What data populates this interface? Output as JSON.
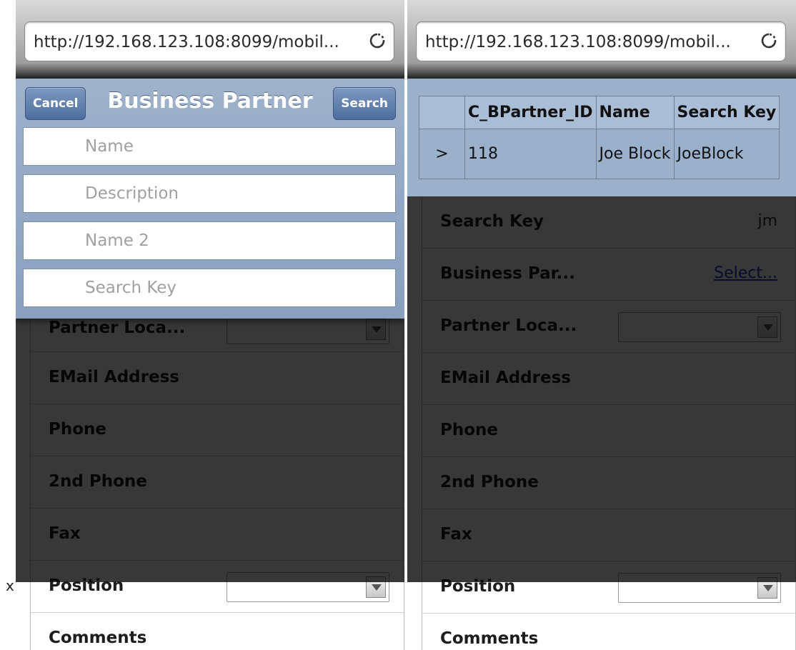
{
  "marker": "x",
  "left_screen": {
    "url": "http://192.168.123.108:8099/mobil...",
    "dialog": {
      "title": "Business Partner",
      "cancel_label": "Cancel",
      "search_label": "Search",
      "placeholders": [
        "Name",
        "Description",
        "Name 2",
        "Search Key"
      ]
    },
    "form_labels": {
      "partner_location": "Partner Loca...",
      "email": "EMail Address",
      "phone": "Phone",
      "phone2": "2nd Phone",
      "fax": "Fax",
      "position": "Position",
      "comments": "Comments"
    }
  },
  "right_screen": {
    "url": "http://192.168.123.108:8099/mobil...",
    "results_table": {
      "headers": [
        "",
        "C_BPartner_ID",
        "Name",
        "Search Key"
      ],
      "rows": [
        [
          ">",
          "118",
          "Joe Block",
          "JoeBlock"
        ]
      ]
    },
    "form": {
      "search_key_label": "Search Key",
      "search_key_value": "jm",
      "business_partner_label": "Business Par...",
      "business_partner_link": "Select...",
      "partner_location": "Partner Loca...",
      "email": "EMail Address",
      "phone": "Phone",
      "phone2": "2nd Phone",
      "fax": "Fax",
      "position": "Position",
      "comments": "Comments"
    }
  },
  "colors": {
    "dialog_blue": "#9fb2cc",
    "button_blue": "#4d6ea0",
    "link_blue": "#1a3ec2",
    "overlay": "rgba(0,0,0,0.78)"
  }
}
